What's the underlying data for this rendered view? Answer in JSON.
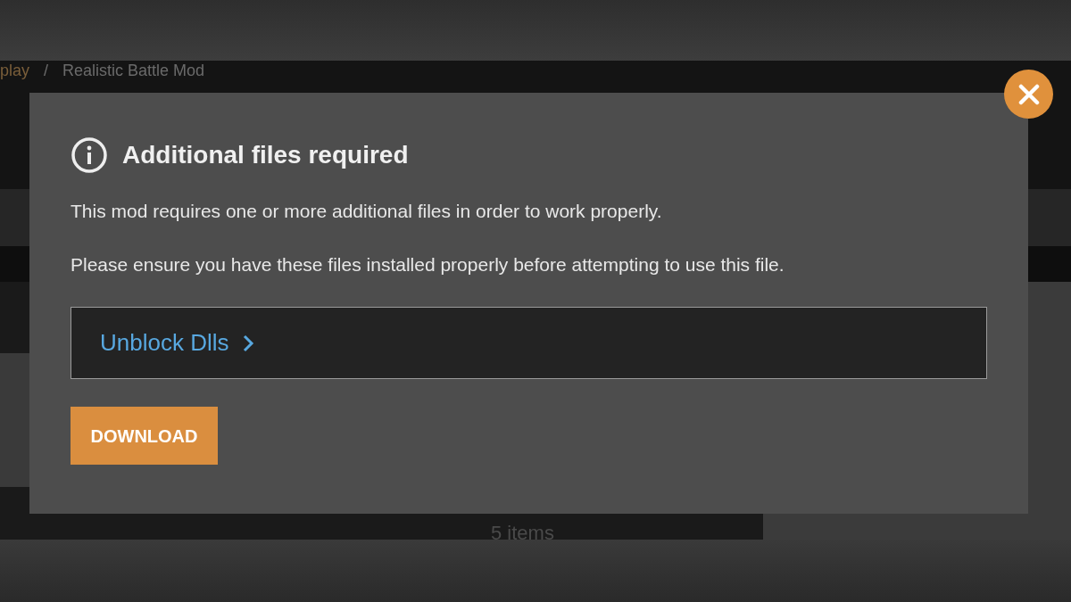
{
  "background": {
    "breadcrumb": [
      "play",
      "/",
      "Realistic Battle Mod"
    ],
    "items_count": "5 items"
  },
  "dialog": {
    "title": "Additional files required",
    "paragraphs": [
      "This mod requires one or more additional files in order to work properly.",
      "Please ensure you have these files installed properly before attempting to use this file."
    ],
    "required_files": [
      {
        "name": "Unblock Dlls"
      }
    ],
    "button": "DOWNLOAD"
  }
}
